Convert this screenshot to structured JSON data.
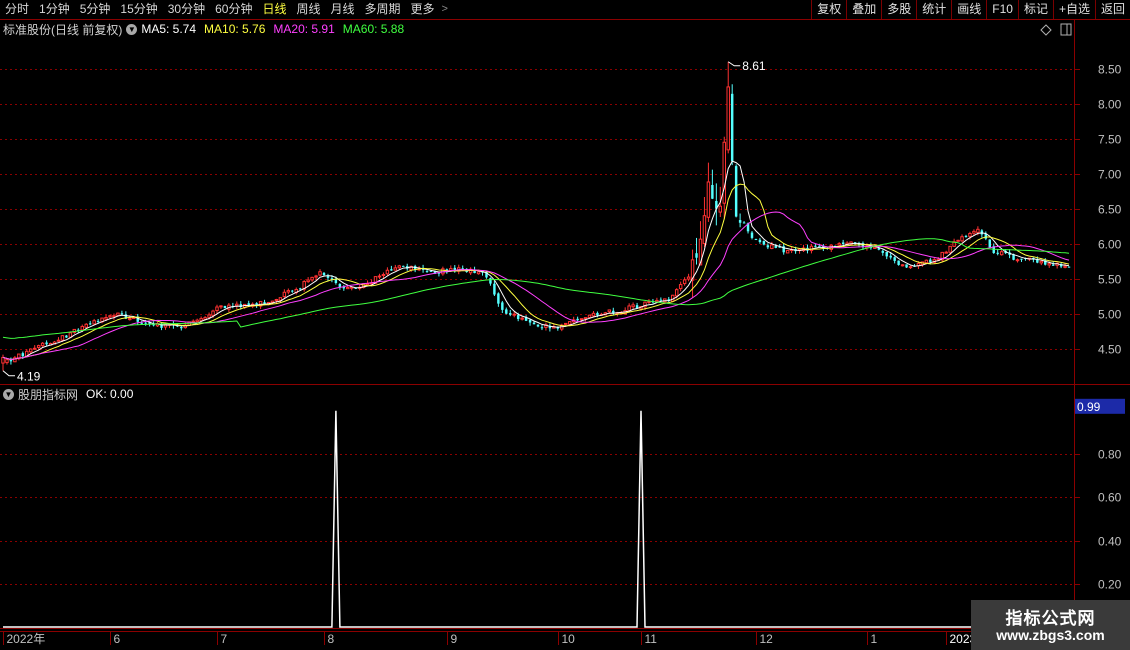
{
  "toolbar": {
    "periods": [
      "分时",
      "1分钟",
      "5分钟",
      "15分钟",
      "30分钟",
      "60分钟",
      "日线",
      "周线",
      "月线",
      "多周期",
      "更多"
    ],
    "active_period": "日线",
    "right_buttons": [
      "复权",
      "叠加",
      "多股",
      "统计",
      "画线",
      "F10",
      "标记",
      "+自选",
      "返回"
    ]
  },
  "main_legend": {
    "title": "标准股份(日线 前复权)",
    "ma": [
      {
        "label": "MA5: 5.74",
        "color": "#ffffff"
      },
      {
        "label": "MA10: 5.76",
        "color": "#ffff40"
      },
      {
        "label": "MA20: 5.91",
        "color": "#ff40ff"
      },
      {
        "label": "MA60: 5.88",
        "color": "#40ff40"
      }
    ]
  },
  "sub_legend": {
    "title": "股朋指标网",
    "value": "OK: 0.00"
  },
  "colors": {
    "up": "#ff3232",
    "down": "#54ffff",
    "grid": "#8b0000",
    "axis_text": "#c0c0c0",
    "ma5": "#ffffff",
    "ma10": "#ffff40",
    "ma20": "#ff40ff",
    "ma60": "#40ff40",
    "indicator": "#ffffff",
    "current_value_bg": "#1c2aa8"
  },
  "chart_data": [
    {
      "type": "candlestick",
      "title": "标准股份(日线 前复权)",
      "y_ticks": [
        4.5,
        5.0,
        5.5,
        6.0,
        6.5,
        7.0,
        7.5,
        8.0,
        8.5
      ],
      "y_tick_labels": [
        "4.50",
        "5.00",
        "5.50",
        "6.00",
        "6.50",
        "7.00",
        "7.50",
        "8.00",
        "8.50"
      ],
      "ylim": [
        4.0,
        8.95
      ],
      "annotations": [
        {
          "label": "8.61",
          "value": 8.61,
          "bar_index": 183,
          "kind": "high"
        },
        {
          "label": "4.19",
          "value": 4.19,
          "bar_index": 0,
          "kind": "low"
        }
      ],
      "x_labels": [
        {
          "label": "2022年",
          "bar_index": 0
        },
        {
          "label": "6",
          "bar_index": 27
        },
        {
          "label": "7",
          "bar_index": 54
        },
        {
          "label": "8",
          "bar_index": 81
        },
        {
          "label": "9",
          "bar_index": 112
        },
        {
          "label": "10",
          "bar_index": 140
        },
        {
          "label": "11",
          "bar_index": 161
        },
        {
          "label": "12",
          "bar_index": 190
        },
        {
          "label": "1",
          "bar_index": 218
        },
        {
          "label": "2023",
          "bar_index": 238
        }
      ],
      "anchors": [
        [
          0,
          4.3
        ],
        [
          8,
          4.5
        ],
        [
          20,
          4.8
        ],
        [
          28,
          5.0
        ],
        [
          38,
          4.85
        ],
        [
          45,
          4.8
        ],
        [
          55,
          5.1
        ],
        [
          65,
          5.15
        ],
        [
          74,
          5.35
        ],
        [
          80,
          5.6
        ],
        [
          86,
          5.35
        ],
        [
          92,
          5.45
        ],
        [
          100,
          5.7
        ],
        [
          108,
          5.6
        ],
        [
          116,
          5.65
        ],
        [
          122,
          5.55
        ],
        [
          126,
          5.05
        ],
        [
          134,
          4.85
        ],
        [
          140,
          4.8
        ],
        [
          148,
          5.0
        ],
        [
          156,
          5.05
        ],
        [
          162,
          5.15
        ],
        [
          168,
          5.2
        ],
        [
          173,
          5.55
        ],
        [
          176,
          6.2
        ],
        [
          178,
          7.0
        ],
        [
          181,
          6.4
        ],
        [
          183,
          8.2
        ],
        [
          185,
          6.5
        ],
        [
          188,
          6.15
        ],
        [
          192,
          6.0
        ],
        [
          198,
          5.9
        ],
        [
          206,
          5.95
        ],
        [
          214,
          6.0
        ],
        [
          220,
          5.95
        ],
        [
          228,
          5.65
        ],
        [
          236,
          5.8
        ],
        [
          242,
          6.1
        ],
        [
          246,
          6.2
        ],
        [
          250,
          5.9
        ],
        [
          255,
          5.8
        ],
        [
          262,
          5.75
        ],
        [
          268,
          5.7
        ]
      ],
      "ma_periods": [
        5,
        10,
        20,
        60
      ],
      "ma_last": {
        "MA5": 5.74,
        "MA10": 5.76,
        "MA20": 5.91,
        "MA60": 5.88
      }
    },
    {
      "type": "line",
      "title": "股朋指标网",
      "series": [
        {
          "name": "OK",
          "last": 0.0
        }
      ],
      "spikes_at_bar_index": [
        84,
        161
      ],
      "spike_value": 1.0,
      "y_ticks": [
        0.2,
        0.4,
        0.6,
        0.8
      ],
      "y_tick_labels": [
        "0.20",
        "0.40",
        "0.60",
        "0.80"
      ],
      "ylim": [
        0.0,
        1.05
      ],
      "current_value_label": "0.99"
    }
  ],
  "watermark": {
    "title": "指标公式网",
    "url": "www.zbgs3.com"
  }
}
